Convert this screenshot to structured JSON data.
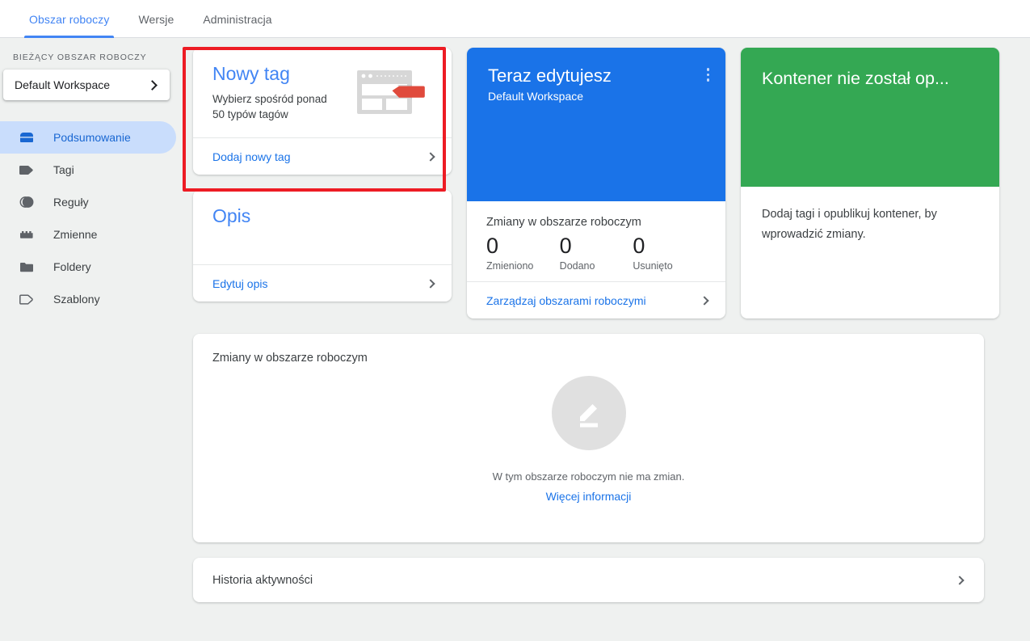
{
  "tabs": [
    {
      "label": "Obszar roboczy",
      "active": true
    },
    {
      "label": "Wersje",
      "active": false
    },
    {
      "label": "Administracja",
      "active": false
    }
  ],
  "sidebar": {
    "workspace_label": "BIEŻĄCY OBSZAR ROBOCZY",
    "workspace_name": "Default Workspace",
    "items": [
      {
        "label": "Podsumowanie",
        "icon": "summary-icon",
        "active": true
      },
      {
        "label": "Tagi",
        "icon": "tag-icon",
        "active": false
      },
      {
        "label": "Reguły",
        "icon": "trigger-icon",
        "active": false
      },
      {
        "label": "Zmienne",
        "icon": "variable-icon",
        "active": false
      },
      {
        "label": "Foldery",
        "icon": "folder-icon",
        "active": false
      },
      {
        "label": "Szablony",
        "icon": "template-icon",
        "active": false
      }
    ]
  },
  "new_tag_card": {
    "title": "Nowy tag",
    "subtitle_line1": "Wybierz spośród ponad",
    "subtitle_line2": "50 typów tagów",
    "action": "Dodaj nowy tag"
  },
  "description_card": {
    "title": "Opis",
    "action": "Edytuj opis"
  },
  "editing_card": {
    "title": "Teraz edytujesz",
    "subtitle": "Default Workspace",
    "stats_title": "Zmiany w obszarze roboczym",
    "stats": [
      {
        "value": "0",
        "label": "Zmieniono"
      },
      {
        "value": "0",
        "label": "Dodano"
      },
      {
        "value": "0",
        "label": "Usunięto"
      }
    ],
    "action": "Zarządzaj obszarami roboczymi"
  },
  "published_card": {
    "title": "Kontener nie został op...",
    "body": "Dodaj tagi i opublikuj kontener, by wprowadzić zmiany."
  },
  "changes_panel": {
    "title": "Zmiany w obszarze roboczym",
    "empty_message": "W tym obszarze roboczym nie ma zmian.",
    "empty_link": "Więcej informacji"
  },
  "history": {
    "label": "Historia aktywności"
  },
  "colors": {
    "accent_blue": "#1a73e8",
    "tab_blue": "#4285f4",
    "green": "#34a853",
    "highlight_red": "#ed1c24",
    "page_bg": "#eff1f0",
    "nav_active_bg": "#c9ddfc"
  }
}
